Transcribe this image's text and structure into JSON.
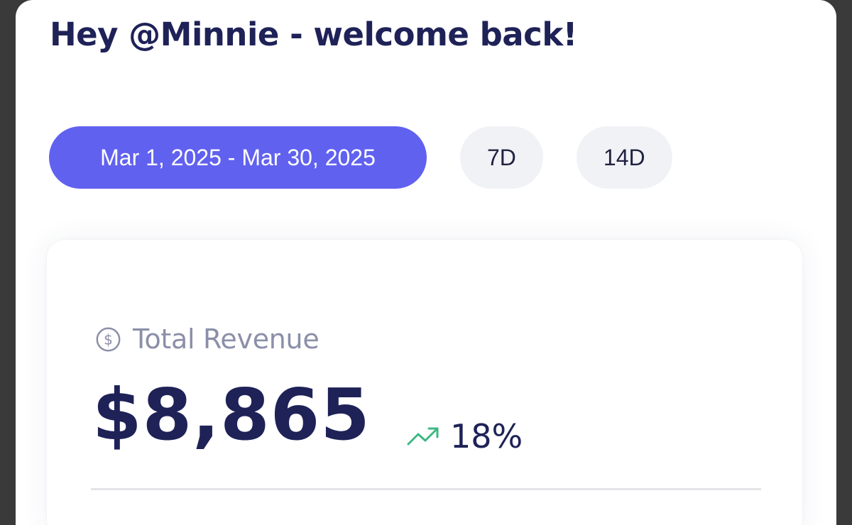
{
  "header": {
    "greeting": "Hey @Minnie - welcome back!"
  },
  "ranges": {
    "items": [
      {
        "label": "Mar 1, 2025 - Mar 30, 2025",
        "active": true
      },
      {
        "label": "7D",
        "active": false
      },
      {
        "label": "14D",
        "active": false
      }
    ]
  },
  "revenue_card": {
    "icon": "dollar-circle-icon",
    "label": "Total Revenue",
    "value": "$8,865",
    "trend": {
      "icon": "trending-up-icon",
      "text": "18%",
      "color": "#3db883"
    }
  },
  "colors": {
    "accent": "#6161f0",
    "heading": "#1e2257",
    "pill_inactive": "#f1f2f6",
    "muted": "#8b8fa8"
  }
}
